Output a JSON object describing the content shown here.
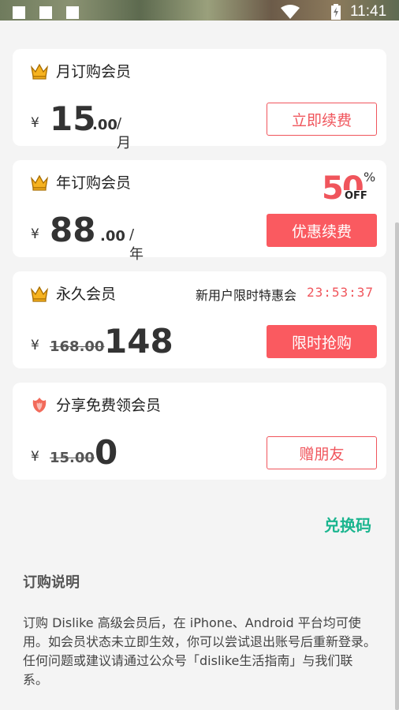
{
  "status_bar": {
    "time": "11:41"
  },
  "plans": [
    {
      "title": "月订购会员",
      "currency": "¥",
      "price_int": "15",
      "price_dec": ".00",
      "unit": "/月",
      "button": "立即续费",
      "icon": "crown-icon"
    },
    {
      "title": "年订购会员",
      "currency": "¥",
      "price_int": "88",
      "price_dec": ".00",
      "unit": "/年",
      "button": "优惠续费",
      "icon": "crown-icon",
      "badge": {
        "number": "50",
        "percent": "%",
        "off": "OFF"
      }
    },
    {
      "title": "永久会员",
      "currency": "¥",
      "old_price": "168.00",
      "price": "148",
      "promo_text": "新用户限时特惠会",
      "countdown": "23:53:37",
      "button": "限时抢购",
      "icon": "crown-icon"
    },
    {
      "title": "分享免费领会员",
      "currency": "¥",
      "old_price": "15.00",
      "price": "0",
      "button": "赠朋友",
      "icon": "rose-icon"
    }
  ],
  "redeem_link": "兑换码",
  "notes": {
    "title": "订购说明",
    "body": "订购 Dislike 高级会员后，在 iPhone、Android 平台均可使用。如会员状态未立即生效，你可以尝试退出账号后重新登录。任何问题或建议请通过公众号「dislike生活指南」与我们联系。"
  },
  "colors": {
    "accent_red": "#fa5a60",
    "accent_green": "#1bb58f",
    "background": "#f4f4f4"
  }
}
